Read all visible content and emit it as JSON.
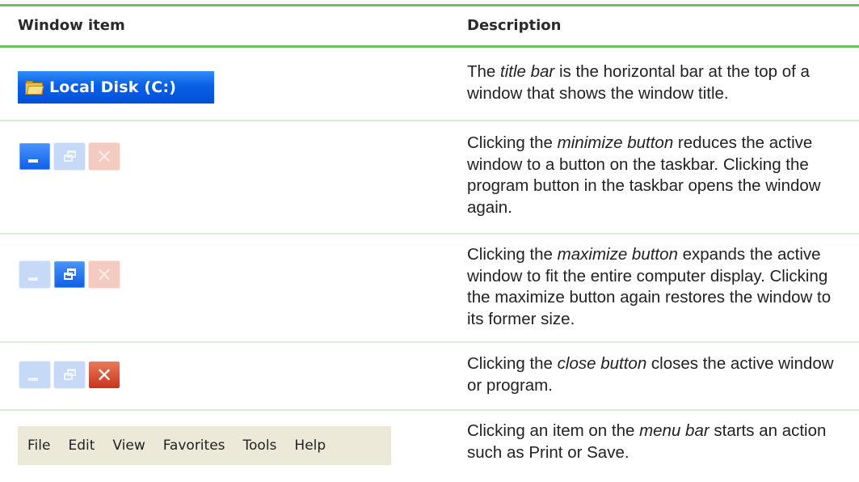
{
  "header": {
    "window_item": "Window item",
    "description": "Description"
  },
  "rows": [
    {
      "item": {
        "type": "title-bar",
        "icon": "folder-icon",
        "label": "Local Disk (C:)"
      },
      "desc_before": "The ",
      "desc_term": "title bar",
      "desc_after": " is the horizontal bar at the top of a window that shows the window title."
    },
    {
      "item": {
        "type": "caption-buttons",
        "highlighted": "minimize"
      },
      "desc_before": "Clicking the ",
      "desc_term": "minimize button",
      "desc_after": " reduces the active window to a button on the taskbar. Clicking the program button in the taskbar opens the window again."
    },
    {
      "item": {
        "type": "caption-buttons",
        "highlighted": "maximize"
      },
      "desc_before": "Clicking the ",
      "desc_term": "maximize button",
      "desc_after": " expands the active window to fit the entire computer display. Clicking the maximize button again restores the window to its former size."
    },
    {
      "item": {
        "type": "caption-buttons",
        "highlighted": "close"
      },
      "desc_before": "Clicking the ",
      "desc_term": "close button",
      "desc_after": " closes the active window or program."
    },
    {
      "item": {
        "type": "menu-bar",
        "menu_items": [
          "File",
          "Edit",
          "View",
          "Favorites",
          "Tools",
          "Help"
        ]
      },
      "desc_before": "Clicking an item on the ",
      "desc_term": "menu bar",
      "desc_after": " starts an action such as Print or Save."
    }
  ],
  "colors": {
    "rule_green": "#6cc15d",
    "row_rule_green": "#d9efd4",
    "xp_blue": "#0a5fe6",
    "xp_red": "#c8341b",
    "menubar_bg": "#ece9d8"
  }
}
